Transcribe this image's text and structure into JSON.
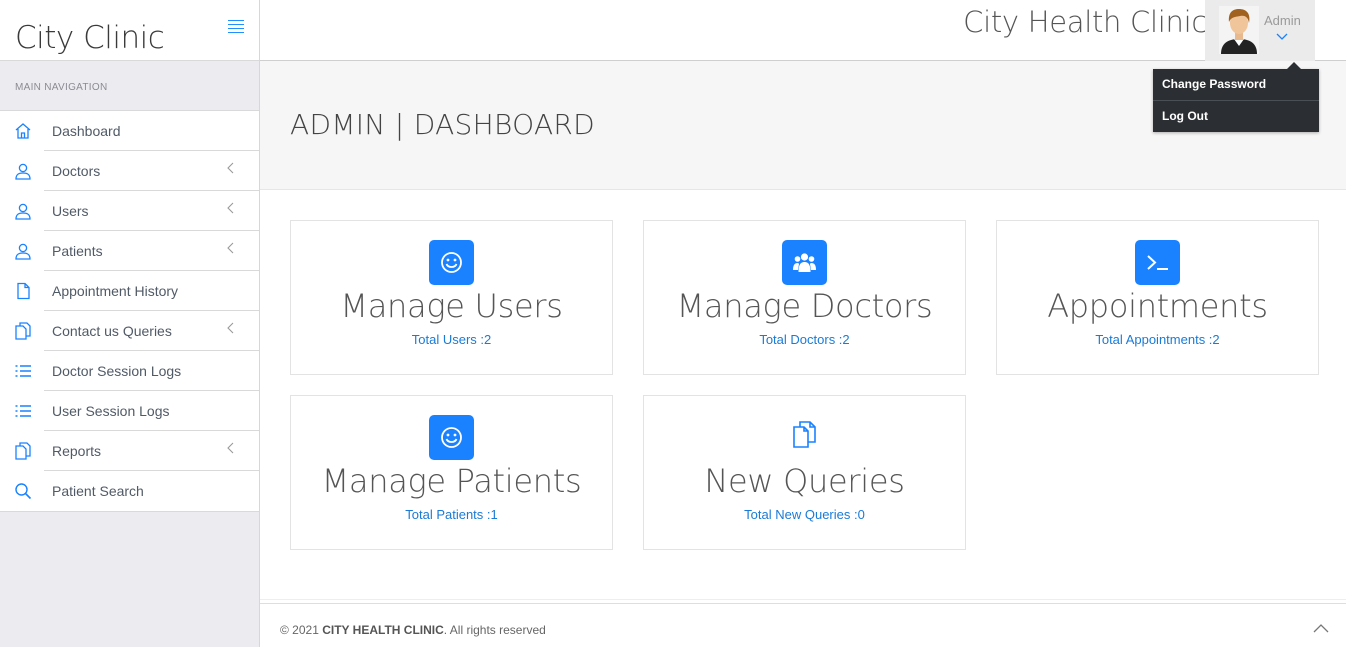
{
  "brand": "City Clinic",
  "nav_label": "MAIN NAVIGATION",
  "nav_items": [
    {
      "label": "Dashboard",
      "icon": "home-icon",
      "has_submenu": false
    },
    {
      "label": "Doctors",
      "icon": "user-icon",
      "has_submenu": true
    },
    {
      "label": "Users",
      "icon": "user-icon",
      "has_submenu": true
    },
    {
      "label": "Patients",
      "icon": "user-icon",
      "has_submenu": true
    },
    {
      "label": "Appointment History",
      "icon": "file-icon",
      "has_submenu": false
    },
    {
      "label": "Contact us Queries",
      "icon": "files-icon",
      "has_submenu": true
    },
    {
      "label": "Doctor Session Logs",
      "icon": "list-icon",
      "has_submenu": false
    },
    {
      "label": "User Session Logs",
      "icon": "list-icon",
      "has_submenu": false
    },
    {
      "label": "Reports",
      "icon": "files-icon",
      "has_submenu": true
    },
    {
      "label": "Patient Search",
      "icon": "search-icon",
      "has_submenu": false
    }
  ],
  "header": {
    "title": "City Health Clinic",
    "user": "Admin",
    "dropdown": [
      "Change Password",
      "Log Out"
    ]
  },
  "page_title": "ADMIN | DASHBOARD",
  "cards": [
    {
      "title": "Manage Users",
      "link": "Total Users :2",
      "icon": "smiley-icon"
    },
    {
      "title": "Manage Doctors",
      "link": "Total Doctors :2",
      "icon": "users-icon"
    },
    {
      "title": "Appointments",
      "link": "Total Appointments :2",
      "icon": "terminal-icon"
    },
    {
      "title": "Manage Patients",
      "link": "Total Patients :1",
      "icon": "smiley-icon"
    },
    {
      "title": "New Queries",
      "link": "Total New Queries :0",
      "icon": "files-icon"
    }
  ],
  "footer": {
    "prefix": "© 2021 ",
    "name": "CITY HEALTH CLINIC",
    "suffix": ". All rights reserved"
  },
  "colors": {
    "accent": "#1a82ff",
    "link": "#1a7bd6",
    "dropdown_bg": "#2b2f33",
    "sidebar_bg": "#ececf0"
  }
}
